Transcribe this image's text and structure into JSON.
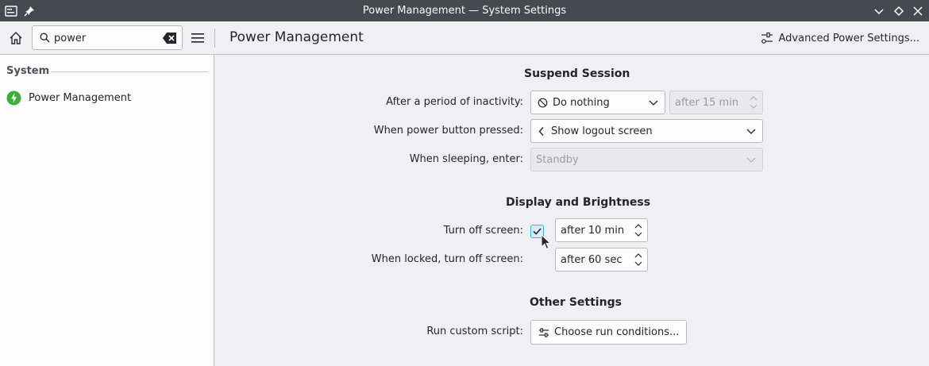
{
  "window": {
    "title": "Power Management — System Settings"
  },
  "toolbar": {
    "search_value": "power",
    "page_title": "Power Management",
    "advanced_label": "Advanced Power Settings..."
  },
  "sidebar": {
    "section": "System",
    "items": [
      {
        "label": "Power Management",
        "icon": "power-management-icon",
        "icon_color": "#3cae3c"
      }
    ]
  },
  "suspend": {
    "header": "Suspend Session",
    "inactivity_label": "After a period of inactivity:",
    "inactivity_value": "Do nothing",
    "inactivity_delay": "after 15 min",
    "power_button_label": "When power button pressed:",
    "power_button_value": "Show logout screen",
    "sleeping_label": "When sleeping, enter:",
    "sleeping_value": "Standby"
  },
  "display": {
    "header": "Display and Brightness",
    "turn_off_label": "Turn off screen:",
    "turn_off_checked": true,
    "turn_off_value": "after 10 min",
    "locked_label": "When locked, turn off screen:",
    "locked_value": "after 60 sec"
  },
  "other": {
    "header": "Other Settings",
    "script_label": "Run custom script:",
    "script_button": "Choose run conditions..."
  },
  "colors": {
    "accent": "#3daee9",
    "titlebar": "#444a4f"
  }
}
